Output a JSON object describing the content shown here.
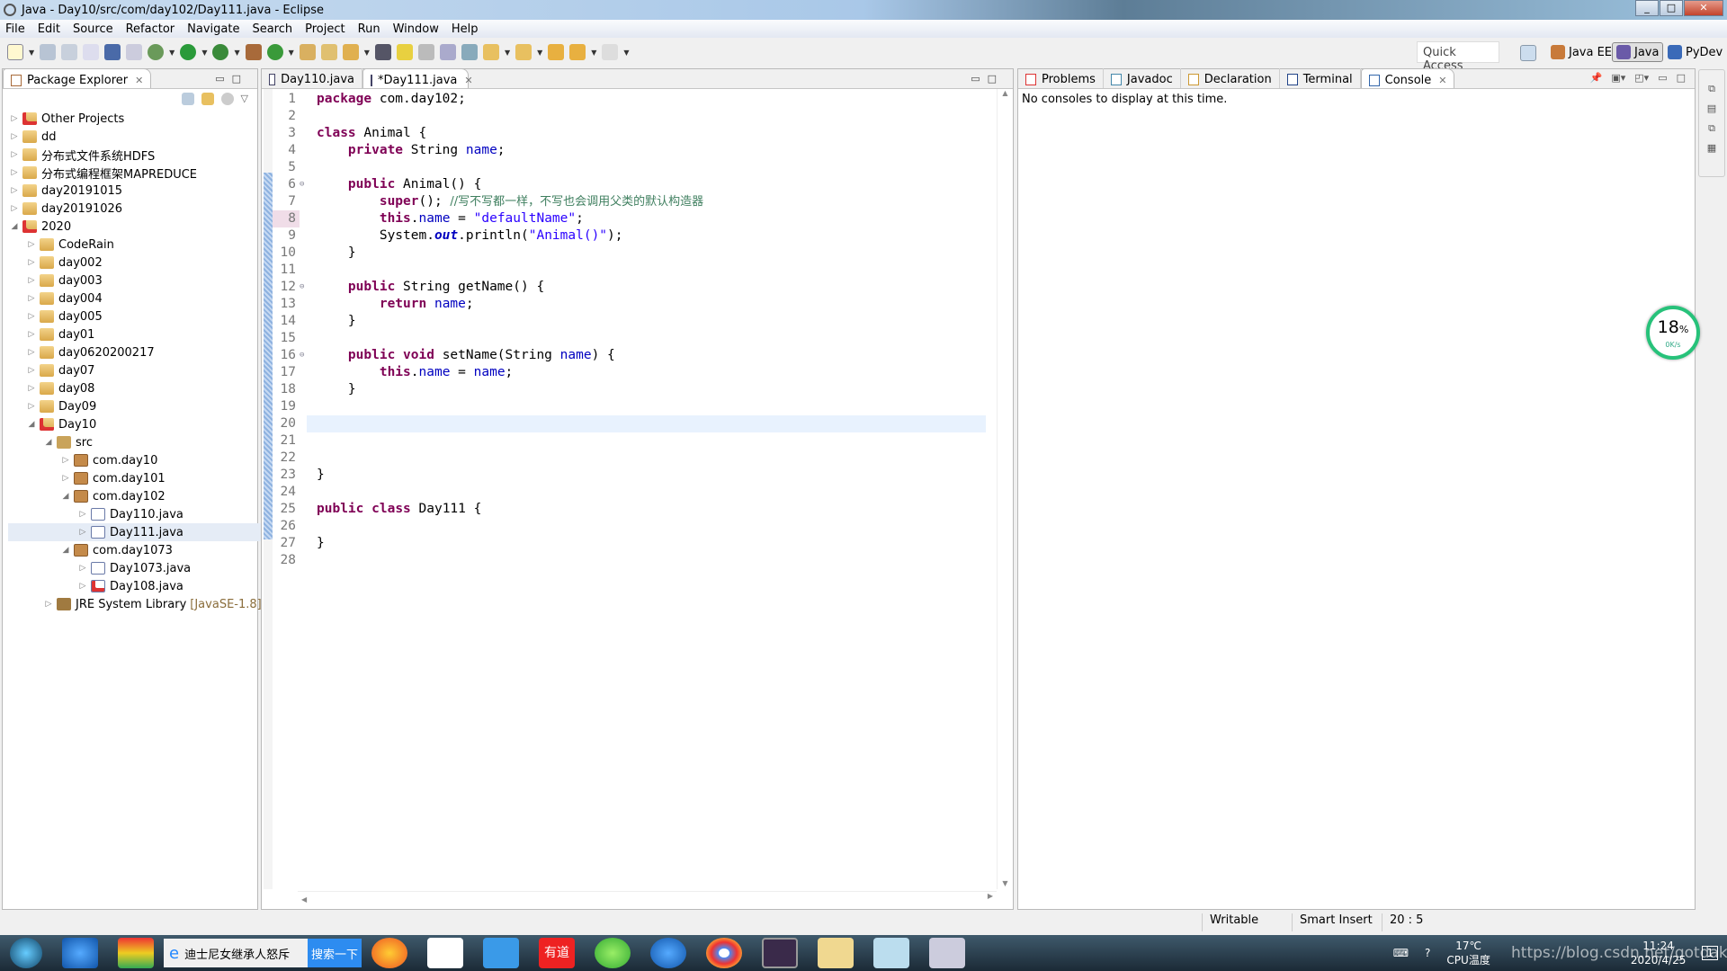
{
  "window": {
    "title": "Java - Day10/src/com/day102/Day111.java - Eclipse"
  },
  "menu": [
    "File",
    "Edit",
    "Source",
    "Refactor",
    "Navigate",
    "Search",
    "Project",
    "Run",
    "Window",
    "Help"
  ],
  "toolbar": {
    "quick_access_placeholder": "Quick Access",
    "perspectives": [
      {
        "label": "Java EE",
        "active": false
      },
      {
        "label": "Java",
        "active": true
      },
      {
        "label": "PyDev",
        "active": false
      }
    ]
  },
  "package_explorer": {
    "title": "Package Explorer",
    "items": [
      {
        "label": "Other Projects",
        "level": 0,
        "expanded": false,
        "icon": "project-error"
      },
      {
        "label": "dd",
        "level": 0,
        "expanded": false,
        "icon": "project-warning"
      },
      {
        "label": "分布式文件系统HDFS",
        "level": 0,
        "expanded": false,
        "icon": "project-warning"
      },
      {
        "label": "分布式编程框架MAPREDUCE",
        "level": 0,
        "expanded": false,
        "icon": "project-warning"
      },
      {
        "label": "day20191015",
        "level": 0,
        "expanded": false,
        "icon": "project-warning"
      },
      {
        "label": "day20191026",
        "level": 0,
        "expanded": false,
        "icon": "project-warning"
      },
      {
        "label": "2020",
        "level": 0,
        "expanded": true,
        "icon": "project-error"
      },
      {
        "label": "CodeRain",
        "level": 1,
        "expanded": false,
        "icon": "project"
      },
      {
        "label": "day002",
        "level": 1,
        "expanded": false,
        "icon": "project"
      },
      {
        "label": "day003",
        "level": 1,
        "expanded": false,
        "icon": "project"
      },
      {
        "label": "day004",
        "level": 1,
        "expanded": false,
        "icon": "project"
      },
      {
        "label": "day005",
        "level": 1,
        "expanded": false,
        "icon": "project"
      },
      {
        "label": "day01",
        "level": 1,
        "expanded": false,
        "icon": "project"
      },
      {
        "label": "day0620200217",
        "level": 1,
        "expanded": false,
        "icon": "project"
      },
      {
        "label": "day07",
        "level": 1,
        "expanded": false,
        "icon": "project"
      },
      {
        "label": "day08",
        "level": 1,
        "expanded": false,
        "icon": "project"
      },
      {
        "label": "Day09",
        "level": 1,
        "expanded": false,
        "icon": "project"
      },
      {
        "label": "Day10",
        "level": 1,
        "expanded": true,
        "icon": "project-error"
      },
      {
        "label": "src",
        "level": 2,
        "expanded": true,
        "icon": "src"
      },
      {
        "label": "com.day10",
        "level": 3,
        "expanded": false,
        "icon": "package"
      },
      {
        "label": "com.day101",
        "level": 3,
        "expanded": false,
        "icon": "package"
      },
      {
        "label": "com.day102",
        "level": 3,
        "expanded": true,
        "icon": "package"
      },
      {
        "label": "Day110.java",
        "level": 4,
        "expanded": false,
        "icon": "java"
      },
      {
        "label": "Day111.java",
        "level": 4,
        "expanded": false,
        "icon": "java",
        "selected": true
      },
      {
        "label": "com.day1073",
        "level": 3,
        "expanded": true,
        "icon": "package"
      },
      {
        "label": "Day1073.java",
        "level": 4,
        "expanded": false,
        "icon": "java"
      },
      {
        "label": "Day108.java",
        "level": 4,
        "expanded": false,
        "icon": "java-error"
      },
      {
        "label": "JRE System Library",
        "decoration": "[JavaSE-1.8]",
        "level": 2,
        "expanded": false,
        "icon": "library"
      }
    ]
  },
  "editor": {
    "tabs": [
      {
        "label": "Day110.java",
        "active": false
      },
      {
        "label": "*Day111.java",
        "active": true
      }
    ],
    "current_line": 20,
    "lines": [
      [
        [
          "package",
          "kw"
        ],
        [
          " com.day102;",
          ""
        ]
      ],
      [],
      [
        [
          "class",
          "kw"
        ],
        [
          " Animal {",
          ""
        ]
      ],
      [
        [
          "    ",
          ""
        ],
        [
          "private",
          "kw"
        ],
        [
          " String ",
          ""
        ],
        [
          "name",
          "fld"
        ],
        [
          ";",
          ""
        ]
      ],
      [],
      [
        [
          "    ",
          ""
        ],
        [
          "public",
          "kw"
        ],
        [
          " Animal() {",
          ""
        ]
      ],
      [
        [
          "        ",
          ""
        ],
        [
          "super",
          "kw"
        ],
        [
          "(); ",
          ""
        ],
        [
          "//写不写都一样，不写也会调用父类的默认构造器",
          "cmt"
        ]
      ],
      [
        [
          "        ",
          ""
        ],
        [
          "this",
          "kw"
        ],
        [
          ".",
          ""
        ],
        [
          "name",
          "fld"
        ],
        [
          " = ",
          ""
        ],
        [
          "\"defaultName\"",
          "str"
        ],
        [
          ";",
          ""
        ]
      ],
      [
        [
          "        System.",
          ""
        ],
        [
          "out",
          "static"
        ],
        [
          ".println(",
          ""
        ],
        [
          "\"Animal()\"",
          "str"
        ],
        [
          ");",
          ""
        ]
      ],
      [
        [
          "    }",
          ""
        ]
      ],
      [],
      [
        [
          "    ",
          ""
        ],
        [
          "public",
          "kw"
        ],
        [
          " String getName() {",
          ""
        ]
      ],
      [
        [
          "        ",
          ""
        ],
        [
          "return",
          "kw"
        ],
        [
          " ",
          ""
        ],
        [
          "name",
          "fld"
        ],
        [
          ";",
          ""
        ]
      ],
      [
        [
          "    }",
          ""
        ]
      ],
      [],
      [
        [
          "    ",
          ""
        ],
        [
          "public",
          "kw"
        ],
        [
          " ",
          ""
        ],
        [
          "void",
          "kw"
        ],
        [
          " setName(String ",
          ""
        ],
        [
          "name",
          "fld"
        ],
        [
          ") {",
          ""
        ]
      ],
      [
        [
          "        ",
          ""
        ],
        [
          "this",
          "kw"
        ],
        [
          ".",
          ""
        ],
        [
          "name",
          "fld"
        ],
        [
          " = ",
          ""
        ],
        [
          "name",
          "fld"
        ],
        [
          ";",
          ""
        ]
      ],
      [
        [
          "    }",
          ""
        ]
      ],
      [],
      [],
      [],
      [],
      [
        [
          "}",
          ""
        ]
      ],
      [],
      [
        [
          "public",
          "kw"
        ],
        [
          " ",
          ""
        ],
        [
          "class",
          "kw"
        ],
        [
          " Day111 {",
          ""
        ]
      ],
      [],
      [
        [
          "}",
          ""
        ]
      ],
      []
    ],
    "fold_lines": [
      6,
      12,
      16
    ]
  },
  "views": {
    "tabs": [
      {
        "label": "Problems"
      },
      {
        "label": "Javadoc"
      },
      {
        "label": "Declaration"
      },
      {
        "label": "Terminal"
      },
      {
        "label": "Console",
        "active": true
      }
    ],
    "console_message": "No consoles to display at this time."
  },
  "memory_widget": {
    "percent": "18",
    "unit": "%",
    "rate": "0K/s"
  },
  "status": {
    "writable": "Writable",
    "insert_mode": "Smart Insert",
    "position": "20 : 5"
  },
  "taskbar": {
    "search_text": "迪士尼女继承人怒斥",
    "search_button": "搜索一下",
    "temperature": "17℃",
    "temp_label": "CPU温度",
    "time": "11:24",
    "date": "2020/4/25",
    "notification_count": "1"
  },
  "watermark": "https://blog.csdn.net/gotdako"
}
